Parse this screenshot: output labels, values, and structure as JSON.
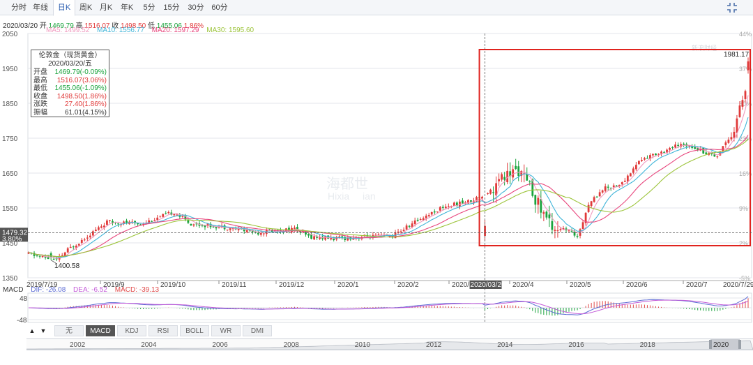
{
  "tabs": {
    "items": [
      "分时",
      "年线",
      "日K",
      "周K",
      "月K",
      "年K",
      "5分",
      "15分",
      "30分",
      "60分"
    ],
    "active": "日K"
  },
  "quote": {
    "date": "2020/03/20",
    "open_label": "开",
    "open": "1469.79",
    "high_label": "高",
    "high": "1516.07",
    "close_label": "收",
    "close": "1498.50",
    "low_label": "低",
    "low": "1455.06",
    "change_pct": "1.86%"
  },
  "ma": {
    "ma5": "MA5: 1499.52",
    "ma10": "MA10: 1556.77",
    "ma20": "MA20: 1597.29",
    "ma30": "MA30: 1595.60",
    "colors": {
      "ma5": "#f09abf",
      "ma10": "#3fb4d8",
      "ma20": "#e8467d",
      "ma30": "#9cc43a"
    }
  },
  "colors": {
    "up": "#e03a3a",
    "down": "#19a33c",
    "box": "#e0231e",
    "grid": "#e3e6eb",
    "axis": "#555555"
  },
  "info_box": {
    "title": "伦敦金（现货黄金）",
    "date": "2020/03/20/五",
    "rows": [
      {
        "label": "开盘",
        "value": "1469.79(-0.09%)",
        "tone": "down"
      },
      {
        "label": "最高",
        "value": "1516.07(3.06%)",
        "tone": "up"
      },
      {
        "label": "最低",
        "value": "1455.06(-1.09%)",
        "tone": "down"
      },
      {
        "label": "收盘",
        "value": "1498.50(1.86%)",
        "tone": "up"
      },
      {
        "label": "涨跌",
        "value": "27.40(1.86%)",
        "tone": "up"
      },
      {
        "label": "振幅",
        "value": "61.01(4.15%)",
        "tone": "neutral"
      }
    ]
  },
  "watermark": {
    "cn": "海都世",
    "en": "Hixia",
    "tail": "ian",
    "logo": "新浪财经"
  },
  "crosshair": {
    "price_label": "1479.32",
    "pct_label": "3.80%",
    "date_label": "2020/03/20"
  },
  "highlight": {
    "from": "2020/03/20",
    "to": "2020/07/29"
  },
  "chart_data": {
    "type": "candlestick",
    "title": "伦敦金（现货黄金）",
    "y_ticks": [
      2050,
      1950,
      1850,
      1750,
      1650,
      1550,
      1450,
      1350
    ],
    "y_labels": [
      "2050",
      "1950",
      "1850",
      "1750",
      "1650",
      "1550",
      "1450",
      "1350"
    ],
    "pct_ticks": [
      "44%",
      "37%",
      "30%",
      "23%",
      "16%",
      "9%",
      "2%",
      "-5%"
    ],
    "x_labels": [
      "2019/7/19",
      "2019/9",
      "2019/10",
      "2019/11",
      "2019/12",
      "2020/1",
      "2020/2",
      "2020/3",
      "2020/4",
      "2020/5",
      "2020/6",
      "2020/7",
      "2020/7/29"
    ],
    "ylim": [
      1350,
      2050
    ],
    "annotations": {
      "min": "1400.58",
      "max": "1981.17"
    },
    "ohlc_on_20200320": {
      "open": 1469.79,
      "high": 1516.07,
      "low": 1455.06,
      "close": 1498.5
    },
    "ma_on_20200320": {
      "MA5": 1499.52,
      "MA10": 1556.77,
      "MA20": 1597.29,
      "MA30": 1595.6
    }
  },
  "macd": {
    "label": "MACD",
    "dif": "DIF: -26.08",
    "dea": "DEA: -6.52",
    "macd": "MACD: -39.13",
    "ticks": [
      "48",
      "-48"
    ],
    "colors": {
      "dif": "#5b6bd4",
      "dea": "#c35bd8",
      "macd": "#e04848",
      "label": "#333333"
    }
  },
  "indicators": {
    "items": [
      "无",
      "MACD",
      "KDJ",
      "RSI",
      "BOLL",
      "WR",
      "DMI"
    ],
    "active": "MACD",
    "prev": "▲",
    "next": "▼"
  },
  "navigator": {
    "years": [
      "2002",
      "2004",
      "2006",
      "2008",
      "2010",
      "2012",
      "2014",
      "2016",
      "2018"
    ],
    "current": "2020"
  }
}
